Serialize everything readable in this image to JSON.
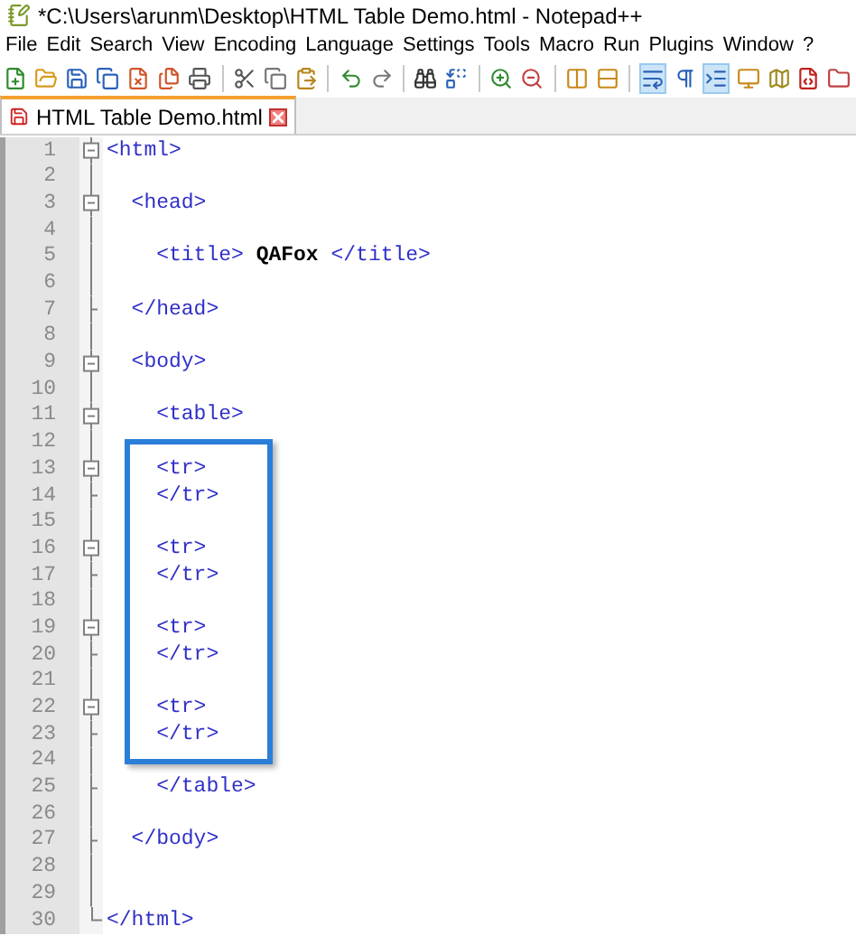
{
  "window": {
    "title": "*C:\\Users\\arunm\\Desktop\\HTML Table Demo.html - Notepad++"
  },
  "menu": [
    "File",
    "Edit",
    "Search",
    "View",
    "Encoding",
    "Language",
    "Settings",
    "Tools",
    "Macro",
    "Run",
    "Plugins",
    "Window",
    "?"
  ],
  "toolbar": [
    {
      "kind": "new",
      "active": false
    },
    {
      "kind": "open",
      "active": false
    },
    {
      "kind": "save",
      "active": false
    },
    {
      "kind": "saveall",
      "active": false
    },
    {
      "kind": "close",
      "active": false
    },
    {
      "kind": "closeall",
      "active": false
    },
    {
      "kind": "print",
      "active": false
    },
    {
      "kind": "sep"
    },
    {
      "kind": "cut",
      "active": false
    },
    {
      "kind": "copy",
      "active": false
    },
    {
      "kind": "paste",
      "active": false
    },
    {
      "kind": "sep"
    },
    {
      "kind": "undo",
      "active": false
    },
    {
      "kind": "redo",
      "active": false
    },
    {
      "kind": "sep"
    },
    {
      "kind": "find",
      "active": false
    },
    {
      "kind": "replace",
      "active": false
    },
    {
      "kind": "sep"
    },
    {
      "kind": "zoomin",
      "active": false
    },
    {
      "kind": "zoomout",
      "active": false
    },
    {
      "kind": "sep"
    },
    {
      "kind": "syncv",
      "active": false
    },
    {
      "kind": "synch",
      "active": false
    },
    {
      "kind": "sep"
    },
    {
      "kind": "wrap",
      "active": true
    },
    {
      "kind": "pilcrow",
      "active": false
    },
    {
      "kind": "indent",
      "active": true
    },
    {
      "kind": "monitor",
      "active": false
    },
    {
      "kind": "map",
      "active": false
    },
    {
      "kind": "func",
      "active": false
    },
    {
      "kind": "folder",
      "active": false
    }
  ],
  "tabs": [
    {
      "label": "HTML Table Demo.html",
      "selected": true,
      "modified": true
    }
  ],
  "lines": [
    {
      "number": "1",
      "kind": "open",
      "parts": [
        {
          "kind": "tag",
          "text": "<html>"
        }
      ]
    },
    {
      "number": "2",
      "kind": "plain"
    },
    {
      "number": "3",
      "kind": "open",
      "parts": [
        {
          "kind": "tag",
          "text": "  <head>"
        }
      ]
    },
    {
      "number": "4",
      "kind": "plain"
    },
    {
      "number": "5",
      "kind": "plain",
      "parts": [
        {
          "kind": "tag",
          "text": "    <title> "
        },
        {
          "kind": "text",
          "text": "QAFox"
        },
        {
          "kind": "tag",
          "text": " </title>"
        }
      ]
    },
    {
      "number": "6",
      "kind": "plain"
    },
    {
      "number": "7",
      "kind": "close",
      "parts": [
        {
          "kind": "tag",
          "text": "  </head>"
        }
      ]
    },
    {
      "number": "8",
      "kind": "plain"
    },
    {
      "number": "9",
      "kind": "open",
      "parts": [
        {
          "kind": "tag",
          "text": "  <body>"
        }
      ]
    },
    {
      "number": "10",
      "kind": "plain"
    },
    {
      "number": "11",
      "kind": "open",
      "parts": [
        {
          "kind": "tag",
          "text": "    <table>"
        }
      ]
    },
    {
      "number": "12",
      "kind": "plain"
    }
  ],
  "highlighted_lines": [
    {
      "number": "13",
      "kind": "open",
      "parts": [
        {
          "kind": "tag",
          "text": "    <tr>"
        }
      ]
    },
    {
      "number": "14",
      "kind": "close",
      "parts": [
        {
          "kind": "tag",
          "text": "    </tr>"
        }
      ]
    },
    {
      "number": "15",
      "kind": "plain"
    },
    {
      "number": "16",
      "kind": "open",
      "parts": [
        {
          "kind": "tag",
          "text": "    <tr>"
        }
      ]
    },
    {
      "number": "17",
      "kind": "close",
      "parts": [
        {
          "kind": "tag",
          "text": "    </tr>"
        }
      ]
    },
    {
      "number": "18",
      "kind": "plain"
    },
    {
      "number": "19",
      "kind": "open",
      "parts": [
        {
          "kind": "tag",
          "text": "    <tr>"
        }
      ]
    },
    {
      "number": "20",
      "kind": "close",
      "parts": [
        {
          "kind": "tag",
          "text": "    </tr>"
        }
      ]
    },
    {
      "number": "21",
      "kind": "plain"
    },
    {
      "number": "22",
      "kind": "open",
      "parts": [
        {
          "kind": "tag",
          "text": "    <tr>"
        }
      ]
    },
    {
      "number": "23",
      "kind": "close",
      "parts": [
        {
          "kind": "tag",
          "text": "    </tr>"
        }
      ]
    }
  ],
  "lines_after": [
    {
      "number": "24",
      "kind": "plain"
    },
    {
      "number": "25",
      "kind": "close",
      "parts": [
        {
          "kind": "tag",
          "text": "    </table>"
        }
      ]
    },
    {
      "number": "26",
      "kind": "plain"
    },
    {
      "number": "27",
      "kind": "close",
      "parts": [
        {
          "kind": "tag",
          "text": "  </body>"
        }
      ]
    },
    {
      "number": "28",
      "kind": "plain"
    },
    {
      "number": "29",
      "kind": "plain"
    },
    {
      "number": "30",
      "kind": "last",
      "parts": [
        {
          "kind": "tag",
          "text": "</html>"
        }
      ]
    }
  ]
}
